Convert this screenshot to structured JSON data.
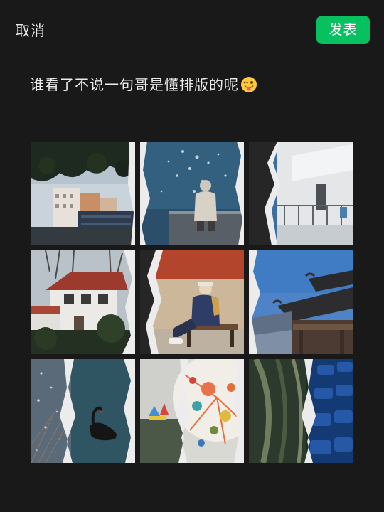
{
  "header": {
    "cancel_label": "取消",
    "publish_label": "发表"
  },
  "post": {
    "caption": "谁看了不说一句哥是懂排版的呢",
    "caption_emoji": "winking-face-with-tongue-emoji"
  },
  "photo_grid": {
    "count": 9,
    "photos": [
      {
        "subject": "city-buildings-under-tree"
      },
      {
        "subject": "person-by-sparkling-water"
      },
      {
        "subject": "white-building-balcony"
      },
      {
        "subject": "white-house-red-roof"
      },
      {
        "subject": "man-on-bench"
      },
      {
        "subject": "chinese-pavilion-roof"
      },
      {
        "subject": "swan-on-water"
      },
      {
        "subject": "colorful-umbrella-art"
      },
      {
        "subject": "blue-stadium-seats"
      }
    ]
  },
  "colors": {
    "background": "#191919",
    "accent": "#07c160",
    "text": "#ececec"
  }
}
